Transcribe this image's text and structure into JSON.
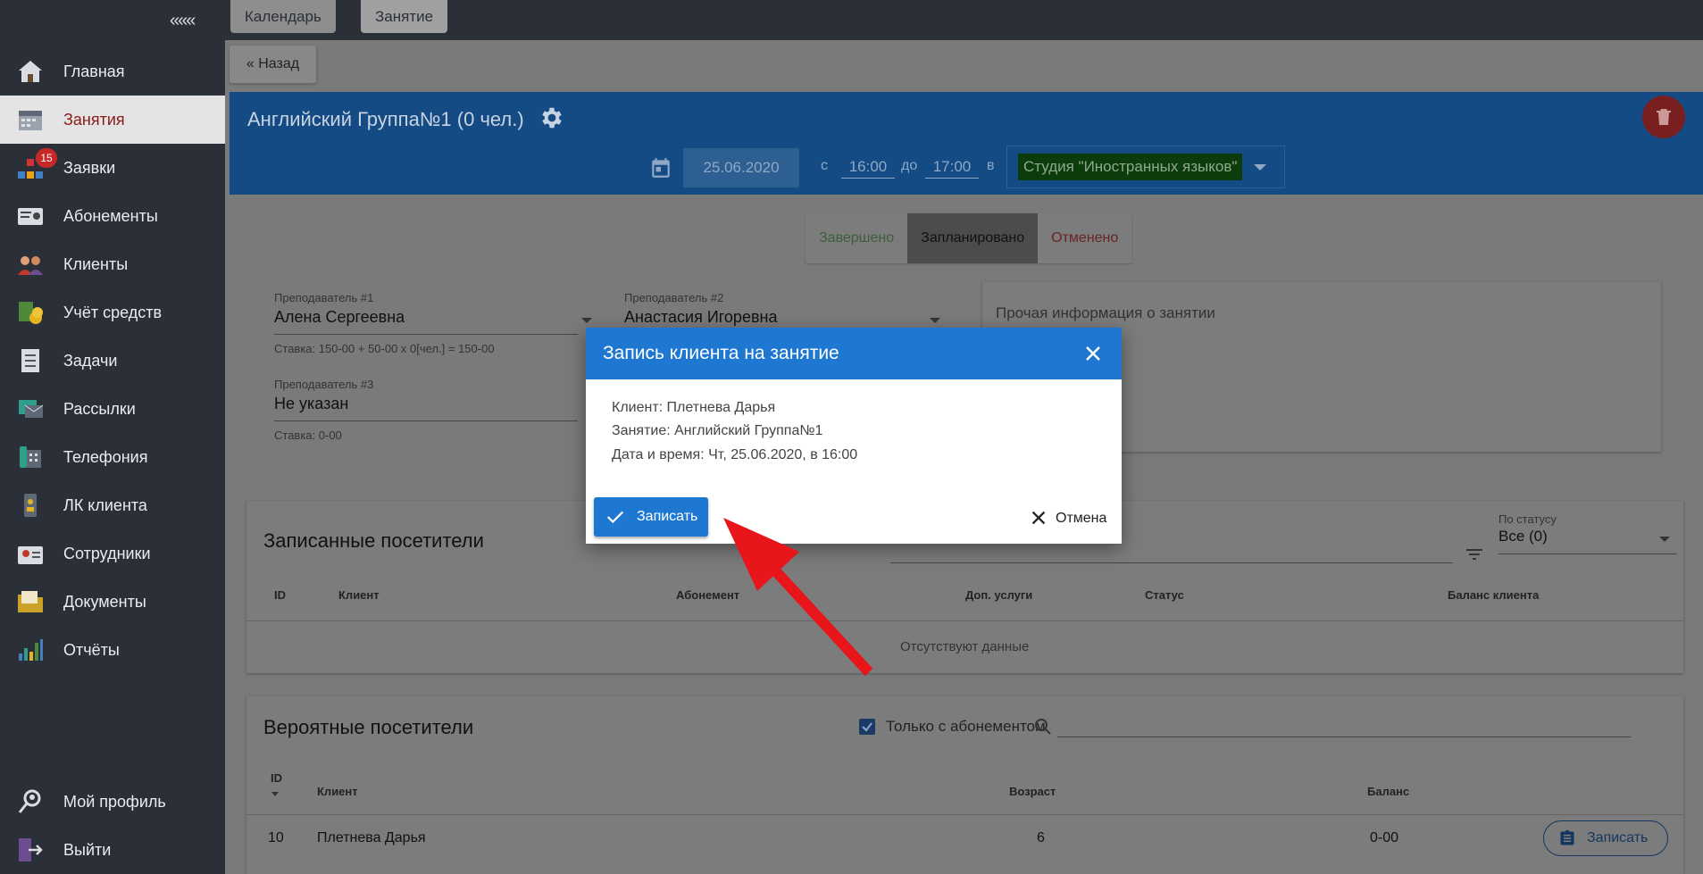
{
  "sidebar": {
    "collapse_label": "«««",
    "items": [
      {
        "label": "Главная",
        "icon": "home-icon"
      },
      {
        "label": "Занятия",
        "icon": "calendar-icon"
      },
      {
        "label": "Заявки",
        "icon": "requests-icon",
        "badge": "15"
      },
      {
        "label": "Абонементы",
        "icon": "subscription-card-icon"
      },
      {
        "label": "Клиенты",
        "icon": "clients-icon"
      },
      {
        "label": "Учёт средств",
        "icon": "money-icon"
      },
      {
        "label": "Задачи",
        "icon": "tasks-icon"
      },
      {
        "label": "Рассылки",
        "icon": "mailing-icon"
      },
      {
        "label": "Телефония",
        "icon": "phone-icon"
      },
      {
        "label": "ЛК клиента",
        "icon": "client-account-icon"
      },
      {
        "label": "Сотрудники",
        "icon": "staff-icon"
      },
      {
        "label": "Документы",
        "icon": "documents-icon"
      },
      {
        "label": "Отчёты",
        "icon": "reports-icon"
      }
    ],
    "bottom": [
      {
        "label": "Мой профиль",
        "icon": "profile-icon"
      },
      {
        "label": "Выйти",
        "icon": "logout-icon"
      }
    ]
  },
  "breadcrumbs": [
    "Календарь",
    "Занятие"
  ],
  "back_label": "« Назад",
  "lesson": {
    "title": "Английский Группа№1 (0 чел.)",
    "date": "25.06.2020",
    "from_label": "с",
    "time_from": "16:00",
    "to_label": "до",
    "time_to": "17:00",
    "in_label": "в",
    "studio": "Студия \"Иностранных языков\""
  },
  "status_tabs": {
    "done": "Завершено",
    "planned": "Запланировано",
    "cancelled": "Отменено"
  },
  "teachers": [
    {
      "caption": "Преподаватель #1",
      "name": "Алена Сергеевна",
      "rate": "Ставка: 150-00 + 50-00 x 0[чел.] = 150-00"
    },
    {
      "caption": "Преподаватель #2",
      "name": "Анастасия Игоревна"
    },
    {
      "caption": "Преподаватель #3",
      "name": "Не указан",
      "rate": "Ставка: 0-00"
    }
  ],
  "info_placeholder": "Прочая информация о занятии",
  "registered": {
    "title": "Записанные посетители",
    "filter_label": "По статусу",
    "filter_value": "Все (0)",
    "columns": [
      "ID",
      "Клиент",
      "Абонемент",
      "Доп. услуги",
      "Статус",
      "Баланс клиента"
    ],
    "empty": "Отсутствуют данные"
  },
  "probable": {
    "title": "Вероятные посетители",
    "only_with_sub": "Только с абонементом",
    "columns": [
      "ID",
      "Клиент",
      "Возраст",
      "Баланс"
    ],
    "rows": [
      {
        "id": "10",
        "client": "Плетнева Дарья",
        "age": "6",
        "balance": "0-00",
        "action": "Записать"
      }
    ]
  },
  "modal": {
    "title": "Запись клиента на занятие",
    "client_line": "Клиент: Плетнева Дарья",
    "lesson_line": "Занятие: Английский Группа№1",
    "datetime_line": "Дата и время: Чт, 25.06.2020, в 16:00",
    "confirm": "Записать",
    "cancel": "Отмена"
  },
  "colors": {
    "accent": "#1e78d2",
    "sidebar": "#2b2f38",
    "annotation_arrow": "#e8151b"
  }
}
